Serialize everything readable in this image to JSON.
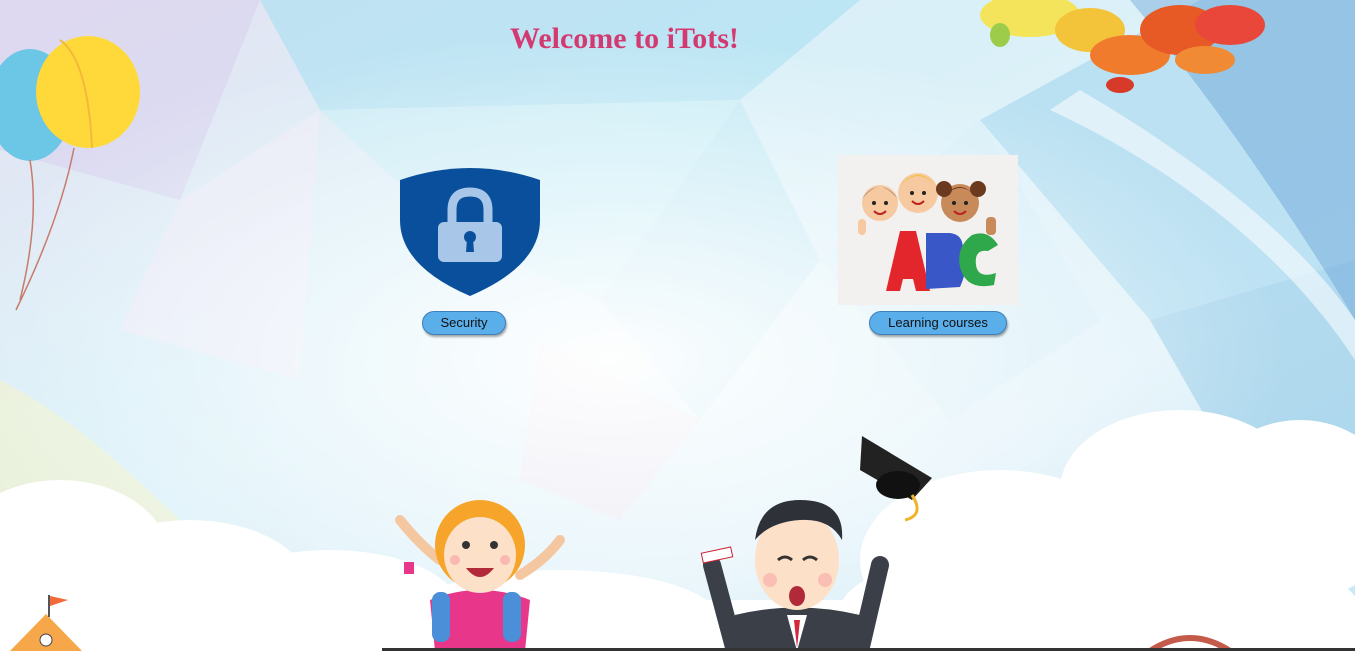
{
  "header": {
    "title": "Welcome to iTots!"
  },
  "tiles": [
    {
      "id": "security",
      "button_label": "Security",
      "icon": "lock-shield-icon"
    },
    {
      "id": "courses",
      "button_label": "Learning courses",
      "icon": "abc-kids-icon"
    }
  ],
  "colors": {
    "title": "#d33a72",
    "button": "#5aaeea",
    "shield": "#0a4f9c"
  }
}
